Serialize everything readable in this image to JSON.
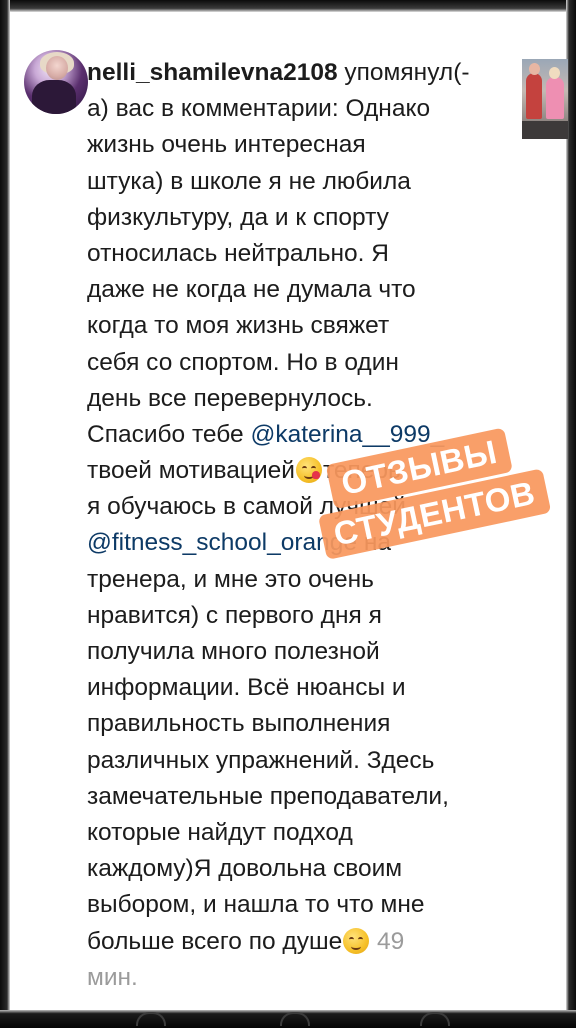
{
  "notification": {
    "username": "nelli_shamilevna2108",
    "lines": [
      [
        "username",
        " упомянул(-"
      ],
      [
        "а) вас в комментарии: Однако"
      ],
      [
        "жизнь очень интересная"
      ],
      [
        "штука) в школе я не любила"
      ],
      [
        "физкультуру, да и к спорту"
      ],
      [
        "относилась нейтрально. Я"
      ],
      [
        "даже не когда не думала что"
      ],
      [
        "когда то моя жизнь свяжет"
      ],
      [
        "себя со спортом. Но в один"
      ],
      [
        "день все перевернулось."
      ],
      [
        "Спасибо тебе ",
        "@katerina__999_"
      ],
      [
        "твоей мотивацией",
        "😘",
        "теперь"
      ],
      [
        "я обучаюсь в самой лучшей"
      ],
      [
        "@fitness_school_orange",
        " на"
      ],
      [
        "тренера, и мне это очень"
      ],
      [
        "нравится) с первого дня я"
      ],
      [
        "получила много полезной"
      ],
      [
        "информации. Всё нюансы и"
      ],
      [
        "правильность выполнения"
      ],
      [
        "различных упражнений. Здесь"
      ],
      [
        "замечательные преподаватели,"
      ],
      [
        "которые найдут подход"
      ],
      [
        "каждому)Я довольна своим"
      ],
      [
        "выбором, и нашла то что мне"
      ],
      [
        "больше всего по душе",
        "😉",
        " 49"
      ],
      [
        "мин."
      ]
    ]
  },
  "sticker": {
    "line1": "ОТЗЫВЫ",
    "line2": "СТУДЕНТОВ",
    "color": "#f9985e"
  },
  "icons": {
    "avatar": "user-avatar-photo",
    "post_thumbnail": "post-thumbnail-photo"
  }
}
